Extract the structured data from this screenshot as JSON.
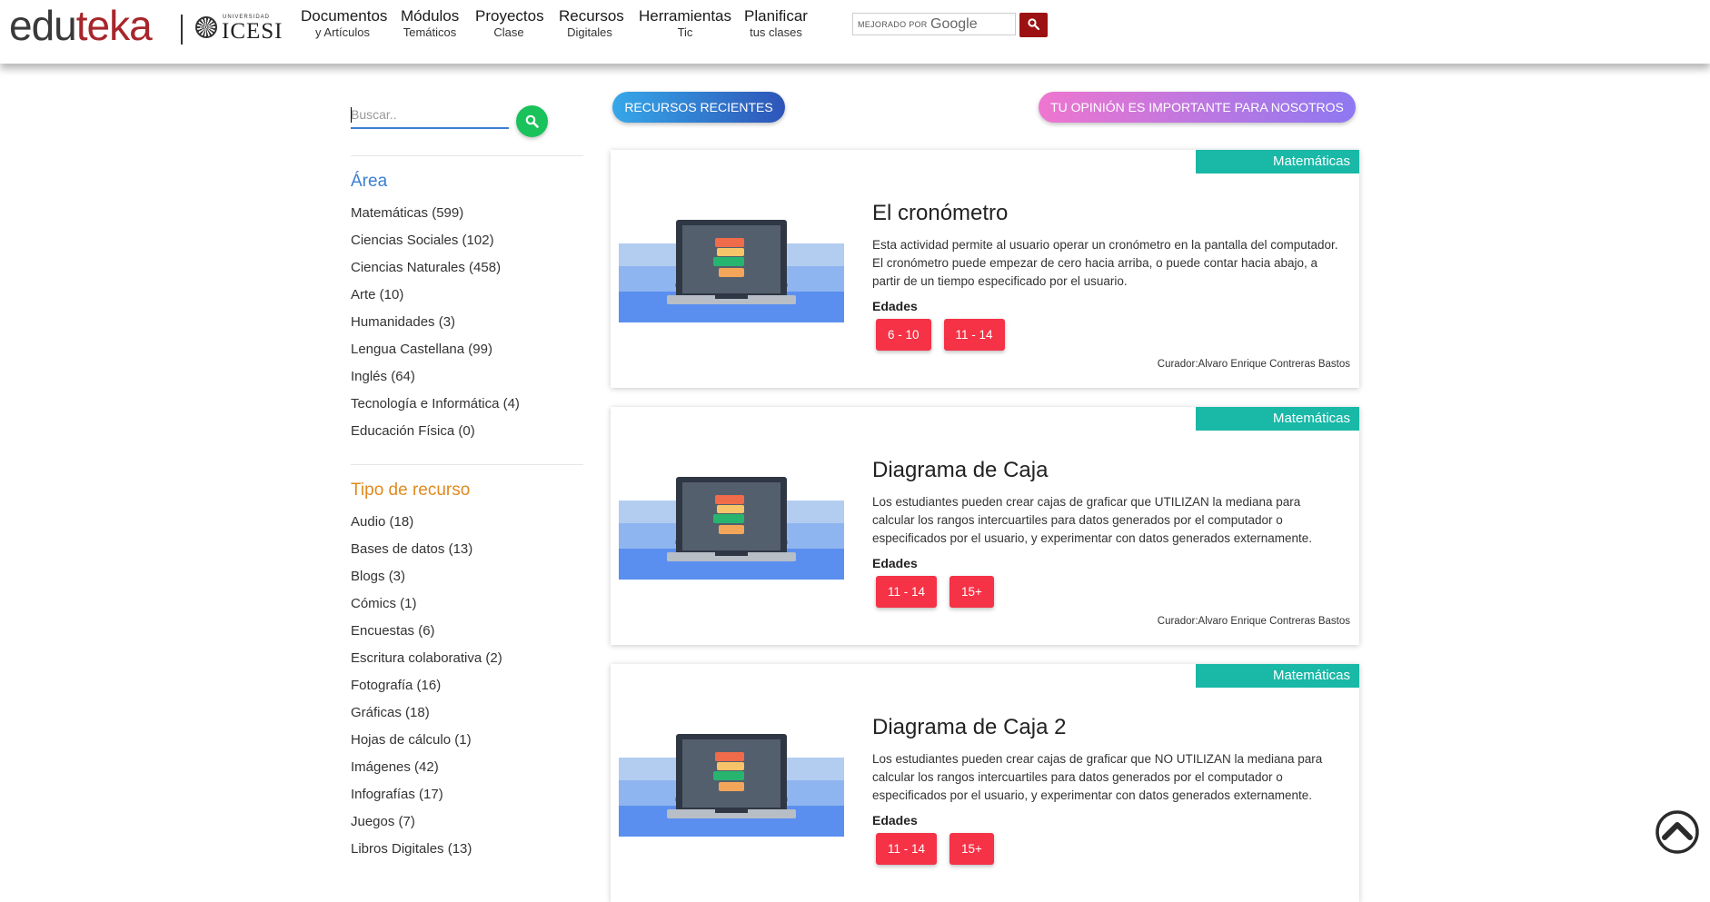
{
  "header": {
    "logo": {
      "part1": "edu",
      "part2": "teka",
      "partner_small": "UNIVERSIDAD",
      "partner_big": "ICESI"
    },
    "nav": [
      {
        "line1": "Documentos",
        "line2": "y Artículos"
      },
      {
        "line1": "Módulos",
        "line2": "Temáticos"
      },
      {
        "line1": "Proyectos",
        "line2": "Clase"
      },
      {
        "line1": "Recursos",
        "line2": "Digitales"
      },
      {
        "line1": "Herramientas",
        "line2": "Tic"
      },
      {
        "line1": "Planificar",
        "line2": "tus clases"
      }
    ],
    "google_search": {
      "enhanced_label": "MEJORADO POR",
      "brand": "Google",
      "button_icon": "search-icon"
    },
    "brand_color": "#a7262b"
  },
  "sidebar": {
    "search": {
      "placeholder": "Buscar..",
      "button_icon": "search-icon"
    },
    "area": {
      "heading": "Área",
      "items": [
        "Matemáticas (599)",
        "Ciencias Sociales (102)",
        "Ciencias Naturales (458)",
        "Arte (10)",
        "Humanidades (3)",
        "Lengua Castellana (99)",
        "Inglés (64)",
        "Tecnología e Informática (4)",
        "Educación Física (0)"
      ]
    },
    "tipo": {
      "heading": "Tipo de recurso",
      "items": [
        "Audio (18)",
        "Bases de datos (13)",
        "Blogs (3)",
        "Cómics (1)",
        "Encuestas (6)",
        "Escritura colaborativa (2)",
        "Fotografía (16)",
        "Gráficas (18)",
        "Hojas de cálculo (1)",
        "Imágenes (42)",
        "Infografías (17)",
        "Juegos (7)",
        "Libros Digitales (13)"
      ]
    }
  },
  "main": {
    "recent_button": "RECURSOS RECIENTES",
    "opinion_button": "TU OPINIÓN ES IMPORTANTE PARA NOSOTROS",
    "cards": [
      {
        "area": "Matemáticas",
        "title": "El cronómetro",
        "description": "Esta actividad permite al usuario operar un cronómetro en la pantalla del computador. El cronómetro puede empezar de cero hacia arriba, o puede contar hacia abajo, a partir de un tiempo especificado por el usuario.",
        "ages_label": "Edades",
        "ages": [
          "6 - 10",
          "11 - 14"
        ],
        "curator": "Curador:Alvaro Enrique Contreras Bastos"
      },
      {
        "area": "Matemáticas",
        "title": "Diagrama de Caja",
        "description": "Los estudiantes pueden crear cajas de graficar que UTILIZAN la mediana para calcular los rangos intercuartiles para datos generados por el computador o especificados por el usuario, y experimentar con datos generados externamente.",
        "ages_label": "Edades",
        "ages": [
          "11 - 14",
          "15+"
        ],
        "curator": "Curador:Alvaro Enrique Contreras Bastos"
      },
      {
        "area": "Matemáticas",
        "title": "Diagrama de Caja 2",
        "description": "Los estudiantes pueden crear cajas de graficar que NO UTILIZAN la mediana para calcular los rangos intercuartiles para datos generados por el computador o especificados por el usuario, y experimentar con datos generados externamente.",
        "ages_label": "Edades",
        "ages": [
          "11 - 14",
          "15+"
        ],
        "curator": ""
      }
    ],
    "thumbnail_icon": "laptop-books-icon",
    "scroll_top_icon": "chevron-up-circle-icon"
  },
  "colors": {
    "area_tag": "#19b8a7",
    "age_badge": "#f53246",
    "area_heading": "#3b7ed4",
    "tipo_heading": "#e08a1e",
    "search_green": "#19c25a"
  }
}
